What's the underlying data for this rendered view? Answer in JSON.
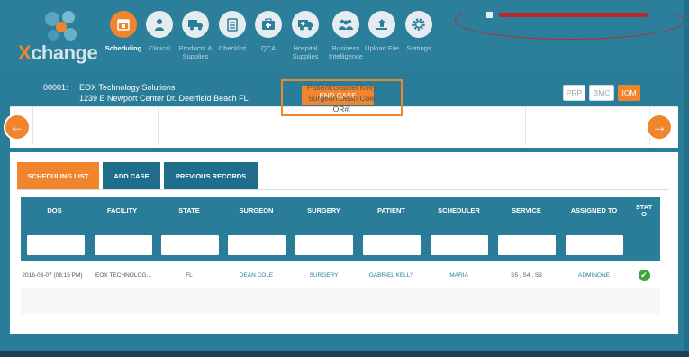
{
  "app": {
    "logo_text": "Xchange",
    "brand_color": "#f0852d",
    "header_color": "#2c7f9b"
  },
  "nav": {
    "items": [
      {
        "label": "Scheduling",
        "icon": "calendar-icon",
        "active": true
      },
      {
        "label": "Clinical",
        "icon": "clinician-icon",
        "active": false
      },
      {
        "label": "Products & Supplies",
        "icon": "truck-icon",
        "active": false
      },
      {
        "label": "Checklist",
        "icon": "checklist-icon",
        "active": false
      },
      {
        "label": "QCA",
        "icon": "medical-kit-icon",
        "active": false
      },
      {
        "label": "Hospital Supplies",
        "icon": "ambulance-icon",
        "active": false
      },
      {
        "label": "Business Intelligence",
        "icon": "group-icon",
        "active": false
      },
      {
        "label": "Upload File",
        "icon": "upload-icon",
        "active": false
      },
      {
        "label": "Settings",
        "icon": "gear-icon",
        "active": false
      }
    ]
  },
  "case": {
    "id": "00001:",
    "org": "EOX Technology Solutions",
    "address": "1239 E Newport Center Dr.  Deerfield Beach FL",
    "end_case_label": "END CASE",
    "tabs": [
      "PRP",
      "BMC",
      "IOM"
    ],
    "active_tab": "IOM",
    "patient_line": "Patient:Gabriel Kelly",
    "surgeon_line": "Surgeon:Dean Cole",
    "or_line": "OR#:"
  },
  "list": {
    "tabs": [
      "SCHEDULING LIST",
      "ADD CASE",
      "PREVIOUS RECORDS"
    ],
    "active_tab": "SCHEDULING LIST",
    "columns": [
      "DOS",
      "FACILITY",
      "STATE",
      "SURGEON",
      "SURGERY",
      "PATIENT",
      "SCHEDULER",
      "SERVICE",
      "ASSIGNED TO",
      "STAT\nO"
    ],
    "rows": [
      {
        "dos": "2016-03-07 (06:15 PM)",
        "facility": "EOX TECHNOLOG...",
        "state": "FL",
        "surgeon": "DEAN COLE",
        "surgery": "SURGERY",
        "patient": "GABRIEL KELLY",
        "scheduler": "MARIA",
        "service": "S5 , S4 , S3",
        "assigned_to": "ADMINONE",
        "status_icon": "check-circle-icon"
      }
    ]
  }
}
